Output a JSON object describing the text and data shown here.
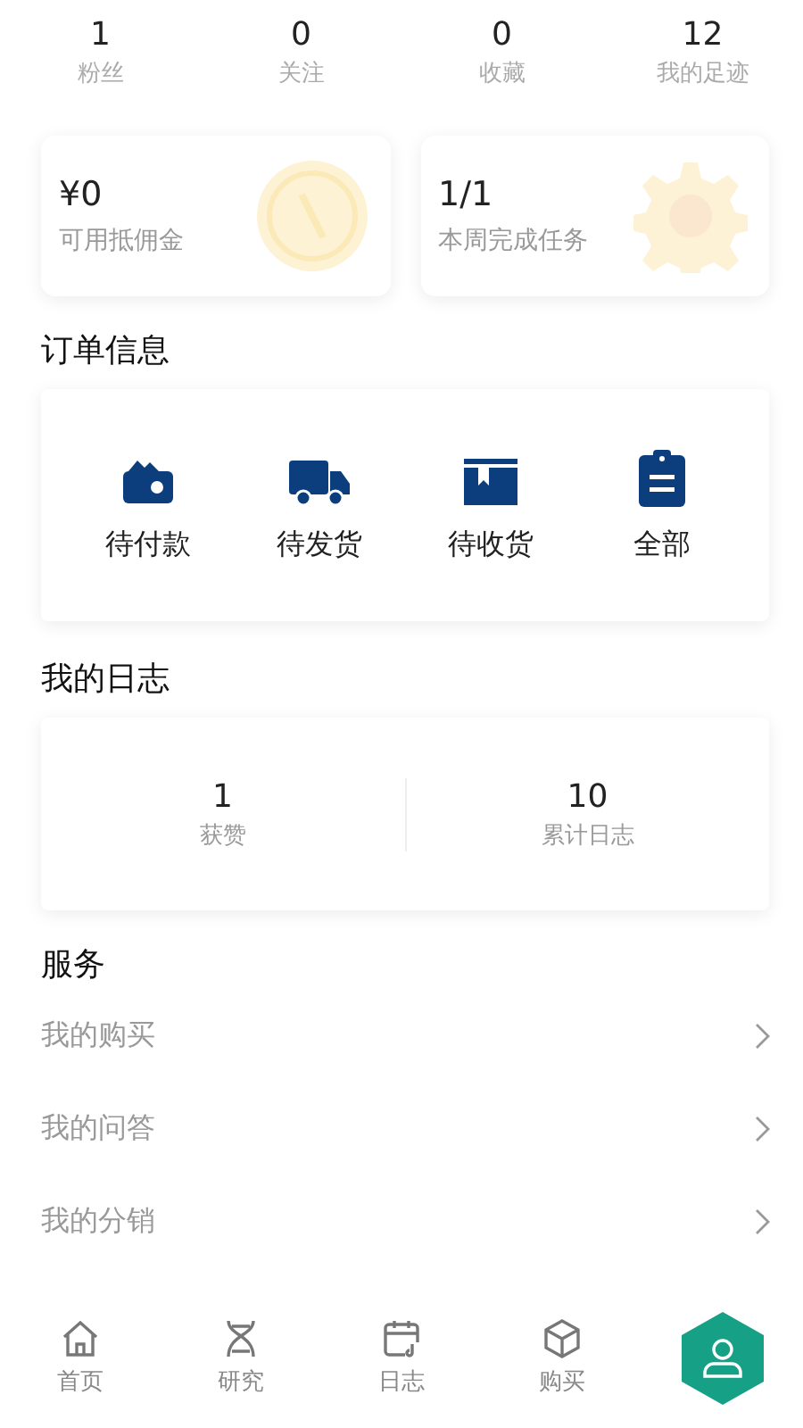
{
  "stats": [
    {
      "value": "1",
      "label": "粉丝"
    },
    {
      "value": "0",
      "label": "关注"
    },
    {
      "value": "0",
      "label": "收藏"
    },
    {
      "value": "12",
      "label": "我的足迹"
    }
  ],
  "summary_cards": [
    {
      "kind": "coin",
      "value": "¥0",
      "label": "可用抵佣金"
    },
    {
      "kind": "gear",
      "value": "1/1",
      "label": "本周完成任务"
    }
  ],
  "orders": {
    "title": "订单信息",
    "items": [
      {
        "kind": "wallet",
        "label": "待付款"
      },
      {
        "kind": "truck",
        "label": "待发货"
      },
      {
        "kind": "box",
        "label": "待收货"
      },
      {
        "kind": "clipboard",
        "label": "全部"
      }
    ]
  },
  "diary": {
    "title": "我的日志",
    "items": [
      {
        "value": "1",
        "label": "获赞"
      },
      {
        "value": "10",
        "label": "累计日志"
      }
    ]
  },
  "services": {
    "title": "服务",
    "items": [
      {
        "label": "我的购买"
      },
      {
        "label": "我的问答"
      },
      {
        "label": "我的分销"
      }
    ]
  },
  "tab_bar": [
    {
      "kind": "home",
      "label": "首页",
      "selected": false
    },
    {
      "kind": "dna",
      "label": "研究",
      "selected": false
    },
    {
      "kind": "calendar",
      "label": "日志",
      "selected": false
    },
    {
      "kind": "cube",
      "label": "购买",
      "selected": false
    },
    {
      "kind": "user",
      "selected": true
    }
  ]
}
